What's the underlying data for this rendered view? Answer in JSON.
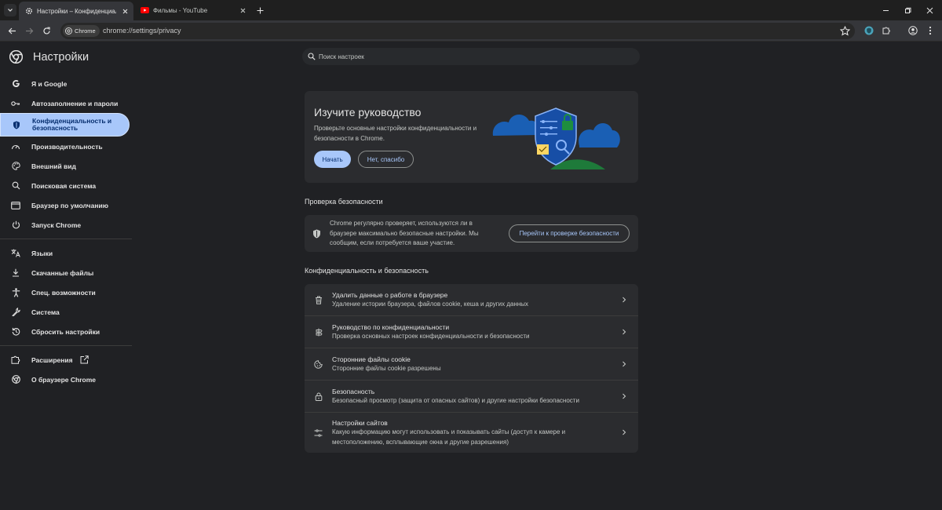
{
  "tabs": [
    {
      "title": "Настройки – Конфиденциальность и безопасность",
      "favicon": "gear-icon",
      "active": true
    },
    {
      "title": "Фильмы - YouTube",
      "favicon": "youtube-icon",
      "active": false
    }
  ],
  "omnibox": {
    "chip_label": "Chrome",
    "url": "chrome://settings/privacy"
  },
  "app": {
    "title": "Настройки"
  },
  "sidebar": {
    "items": [
      {
        "label": "Я и Google",
        "icon": "google-icon"
      },
      {
        "label": "Автозаполнение и пароли",
        "icon": "key-icon"
      },
      {
        "label": "Конфиденциальность и безопасность",
        "icon": "shield-icon",
        "selected": true
      },
      {
        "label": "Производительность",
        "icon": "speedometer-icon"
      },
      {
        "label": "Внешний вид",
        "icon": "palette-icon"
      },
      {
        "label": "Поисковая система",
        "icon": "search-icon"
      },
      {
        "label": "Браузер по умолчанию",
        "icon": "browser-icon"
      },
      {
        "label": "Запуск Chrome",
        "icon": "power-icon"
      },
      {
        "label": "Языки",
        "icon": "translate-icon"
      },
      {
        "label": "Скачанные файлы",
        "icon": "download-icon"
      },
      {
        "label": "Спец. возможности",
        "icon": "accessibility-icon"
      },
      {
        "label": "Система",
        "icon": "wrench-icon"
      },
      {
        "label": "Сбросить настройки",
        "icon": "reset-icon"
      },
      {
        "label": "Расширения",
        "icon": "puzzle-icon"
      },
      {
        "label": "О браузере Chrome",
        "icon": "chrome-icon"
      }
    ]
  },
  "search": {
    "placeholder": "Поиск настроек"
  },
  "guide": {
    "title": "Изучите руководство",
    "description": "Проверьте основные настройки конфиденциальности и безопасности в Chrome.",
    "start_label": "Начать",
    "dismiss_label": "Нет, спасибо"
  },
  "safety_check": {
    "section_title": "Проверка безопасности",
    "description": "Chrome регулярно проверяет, используются ли в браузере максимально безопасные настройки. Мы сообщим, если потребуется ваше участие.",
    "button_label": "Перейти к проверке безопасности"
  },
  "privacy": {
    "section_title": "Конфиденциальность и безопасность",
    "rows": [
      {
        "title": "Удалить данные о работе в браузере",
        "subtitle": "Удаление истории браузера, файлов cookie, кеша и других данных",
        "icon": "trash-icon"
      },
      {
        "title": "Руководство по конфиденциальности",
        "subtitle": "Проверка основных настроек конфиденциальности и безопасности",
        "icon": "guide-icon"
      },
      {
        "title": "Сторонние файлы cookie",
        "subtitle": "Сторонние файлы cookie разрешены",
        "icon": "cookie-icon"
      },
      {
        "title": "Безопасность",
        "subtitle": "Безопасный просмотр (защита от опасных сайтов) и другие настройки безопасности",
        "icon": "lock-icon"
      },
      {
        "title": "Настройки сайтов",
        "subtitle": "Какую информацию могут использовать и показывать сайты (доступ к камере и местоположению, всплывающие окна и другие разрешения)",
        "icon": "tune-icon"
      }
    ]
  },
  "colors": {
    "accent": "#a8c7fa",
    "background": "#202124",
    "card": "#2b2c2f"
  }
}
